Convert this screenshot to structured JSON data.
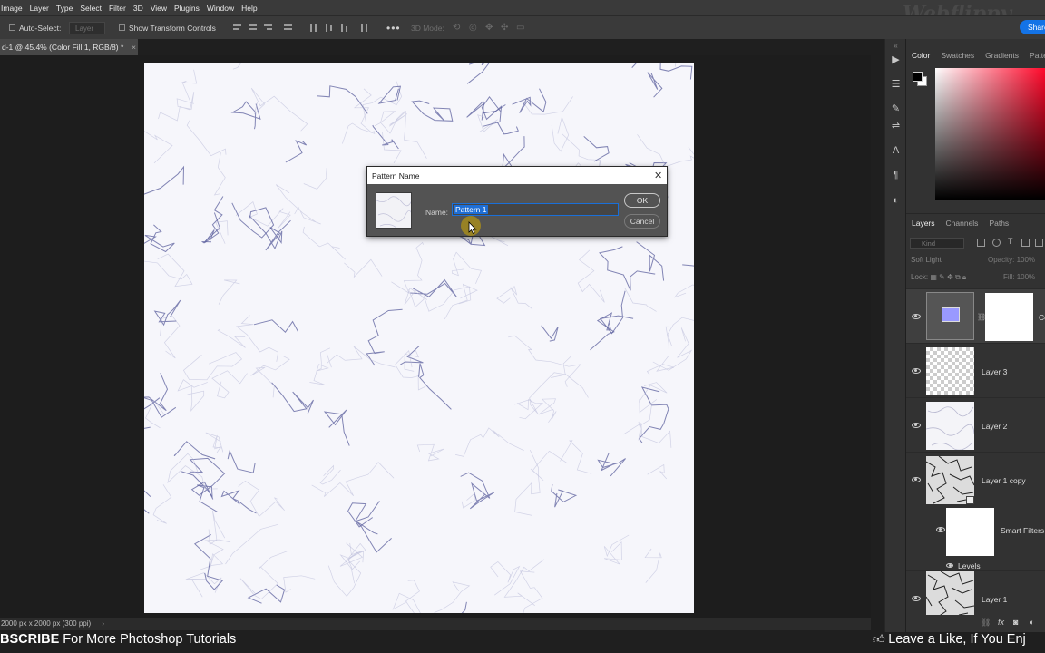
{
  "menu": [
    "Image",
    "Layer",
    "Type",
    "Select",
    "Filter",
    "3D",
    "View",
    "Plugins",
    "Window",
    "Help"
  ],
  "share_label": "Share",
  "options": {
    "auto_select_label": "Auto-Select:",
    "layer_select_value": "Layer",
    "show_transform_label": "Show Transform Controls",
    "mode_3d_label": "3D Mode:"
  },
  "document": {
    "tab_title": "d-1 @ 45.4% (Color Fill 1, RGB/8) *",
    "status": "2000 px x 2000 px (300 ppi)"
  },
  "dialog": {
    "title": "Pattern Name",
    "name_label": "Name:",
    "name_value": "Pattern 1",
    "ok_label": "OK",
    "cancel_label": "Cancel"
  },
  "color_panel": {
    "tabs": [
      "Color",
      "Swatches",
      "Gradients",
      "Patte"
    ],
    "foreground": "#000000",
    "background": "#ffffff",
    "hue": "#ff0023"
  },
  "layers_panel": {
    "tabs": [
      "Layers",
      "Channels",
      "Paths"
    ],
    "filter_placeholder": "Kind",
    "blend_mode": "Soft Light",
    "opacity_label": "Opacity:",
    "opacity_value": "100%",
    "lock_label": "Lock:",
    "fill_label": "Fill:",
    "fill_value": "100%",
    "layers": [
      {
        "name": "Co",
        "kind": "color-fill",
        "selected": true
      },
      {
        "name": "Layer 3",
        "kind": "transparent"
      },
      {
        "name": "Layer 2",
        "kind": "marble-light"
      },
      {
        "name": "Layer 1 copy",
        "kind": "marble-dark"
      },
      {
        "name": "Smart Filters",
        "kind": "white"
      },
      {
        "name": "Levels",
        "kind": "filter"
      },
      {
        "name": "Layer 1",
        "kind": "marble-dark"
      }
    ]
  },
  "banner": {
    "left_bold": "BSCRIBE",
    "left_text": " For More Photoshop Tutorials",
    "right_text": "Leave a Like, If You Enj"
  }
}
